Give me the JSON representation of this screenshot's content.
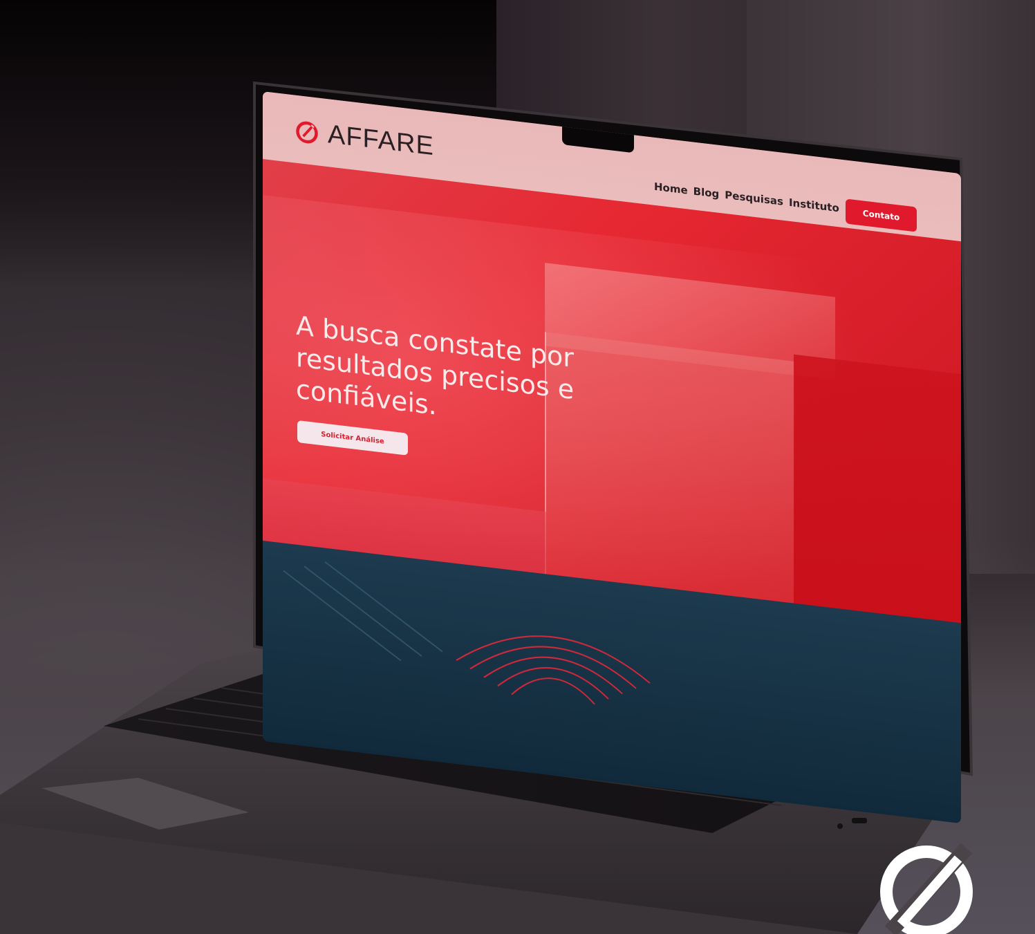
{
  "site": {
    "brand": "AFFARE",
    "nav": [
      "Home",
      "Blog",
      "Pesquisas",
      "Instituto"
    ],
    "contact_label": "Contato",
    "headline": "A busca constate por resultados precisos e confiáveis.",
    "cta_label": "Solicitar Análise"
  },
  "colors": {
    "accent": "#e01a2c",
    "nav_bg": "#ebbcbc",
    "band": "#112a3b"
  },
  "icons": {
    "logo": "affare-logo-icon",
    "watermark": "affare-watermark-icon"
  }
}
